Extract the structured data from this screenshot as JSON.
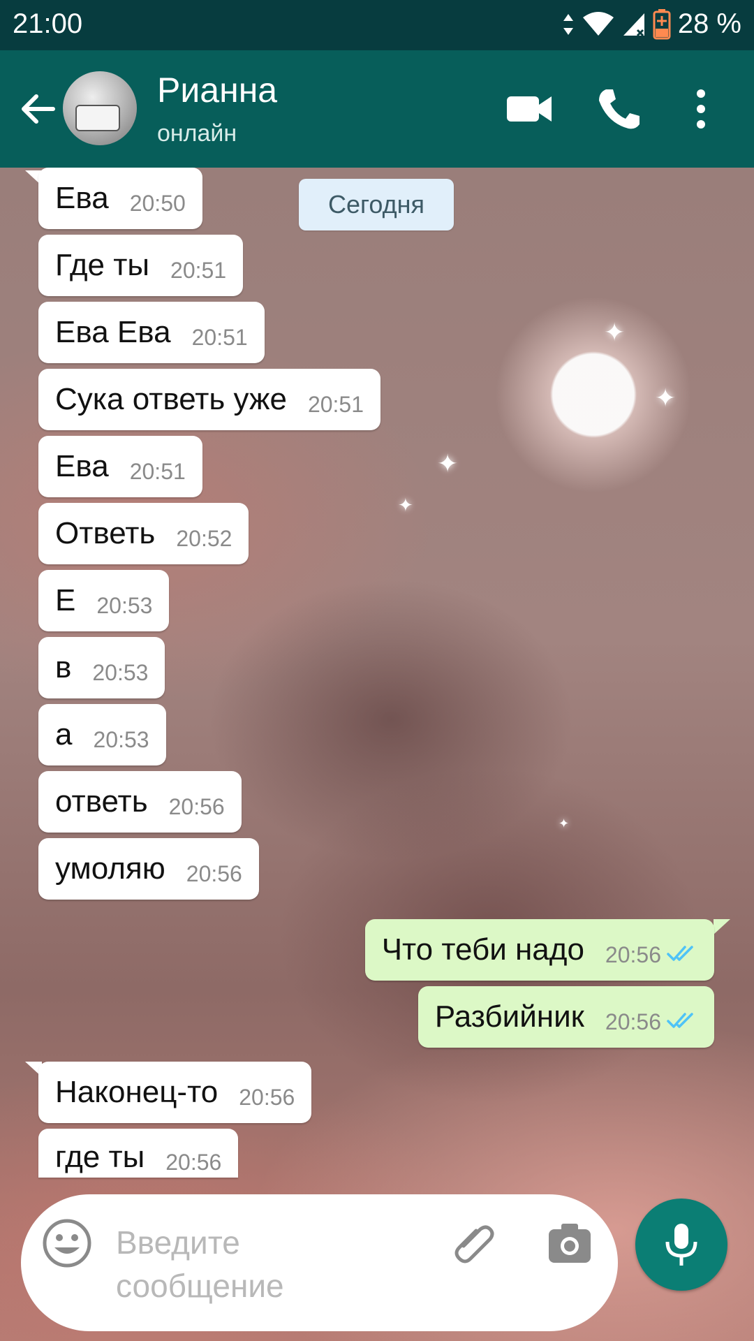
{
  "status_bar": {
    "time": "21:00",
    "battery": "28 %",
    "icons": [
      "data-arrows-icon",
      "wifi-icon",
      "signal-icon",
      "battery-charging-icon"
    ]
  },
  "header": {
    "contact_name": "Рианна",
    "status": "онлайн",
    "icons": [
      "back-arrow-icon",
      "avatar",
      "video-call-icon",
      "phone-icon",
      "more-vert-icon"
    ]
  },
  "date_chip": "Сегодня",
  "messages": [
    {
      "dir": "in",
      "text": "Ева",
      "time": "20:50"
    },
    {
      "dir": "in",
      "text": "Где ты",
      "time": "20:51"
    },
    {
      "dir": "in",
      "text": "Ева Ева",
      "time": "20:51"
    },
    {
      "dir": "in",
      "text": "Сука ответь уже",
      "time": "20:51"
    },
    {
      "dir": "in",
      "text": "Ева",
      "time": "20:51"
    },
    {
      "dir": "in",
      "text": "Ответь",
      "time": "20:52"
    },
    {
      "dir": "in",
      "text": "Е",
      "time": "20:53"
    },
    {
      "dir": "in",
      "text": "в",
      "time": "20:53"
    },
    {
      "dir": "in",
      "text": "а",
      "time": "20:53"
    },
    {
      "dir": "in",
      "text": "ответь",
      "time": "20:56"
    },
    {
      "dir": "in",
      "text": "умоляю",
      "time": "20:56"
    },
    {
      "dir": "out",
      "text": "Что теби надо",
      "time": "20:56",
      "read": true
    },
    {
      "dir": "out",
      "text": "Разбийник",
      "time": "20:56",
      "read": true
    },
    {
      "dir": "in",
      "text": "Наконец-то",
      "time": "20:56"
    },
    {
      "dir": "in",
      "text": "где ты",
      "time": "20:56"
    }
  ],
  "input": {
    "placeholder": "Введите сообщение",
    "icons": [
      "emoji-icon",
      "attach-icon",
      "camera-icon",
      "mic-icon"
    ]
  },
  "colors": {
    "status_bar": "#073c3f",
    "app_bar": "#075e5a",
    "incoming_bubble": "#ffffff",
    "outgoing_bubble": "#dcf8c6",
    "read_ticks": "#4fc3f7",
    "mic_button": "#0b7e74"
  }
}
